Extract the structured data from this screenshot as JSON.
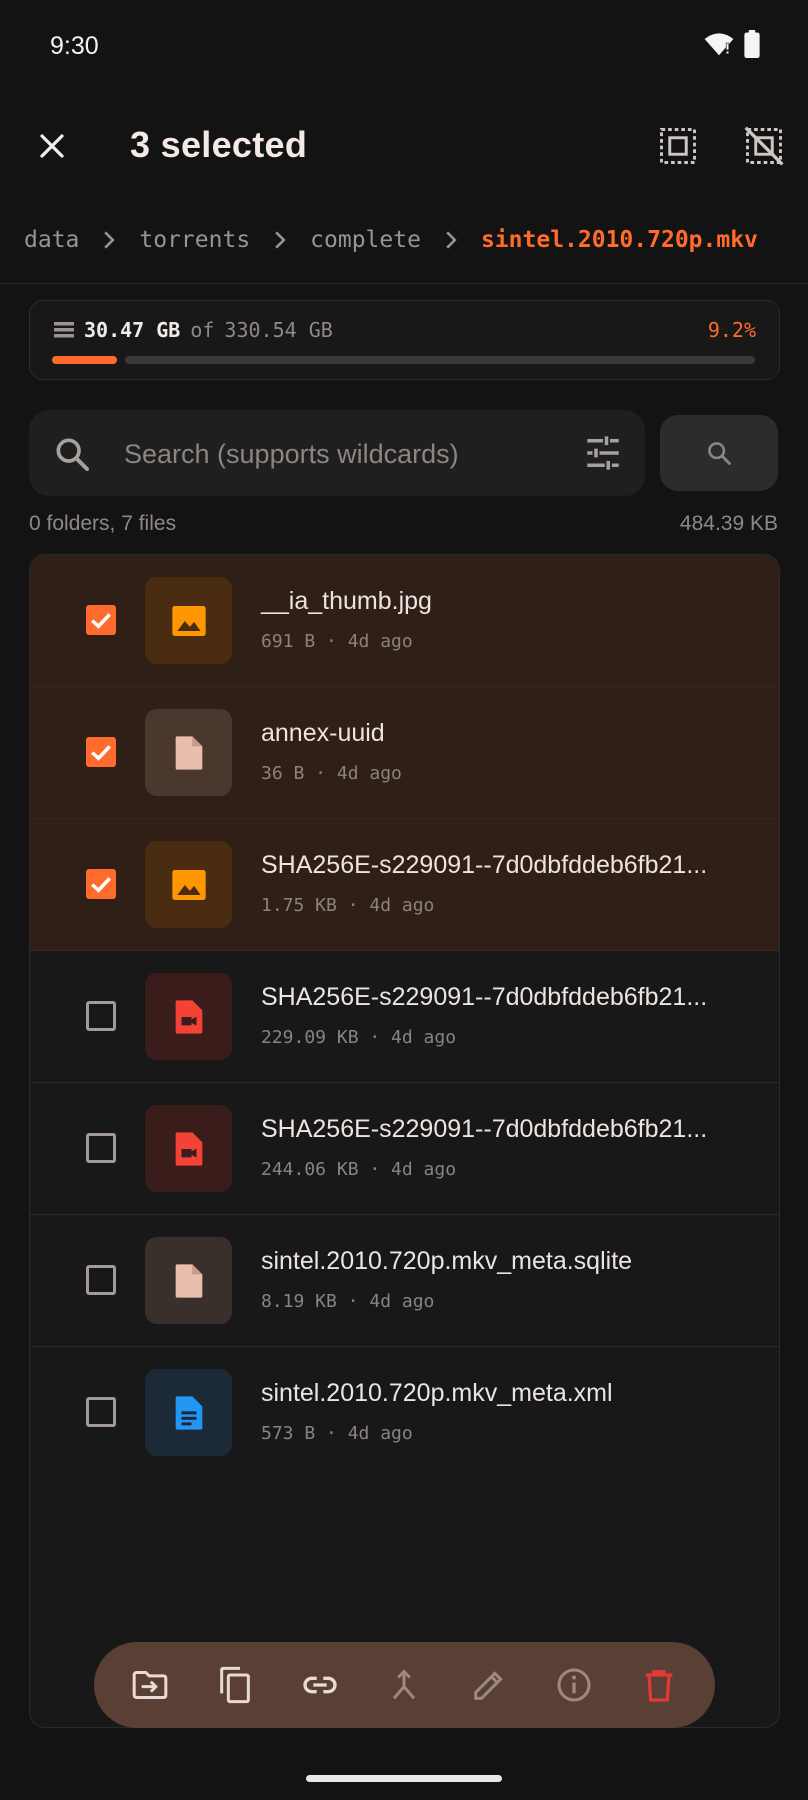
{
  "status_bar": {
    "time": "9:30"
  },
  "app_bar": {
    "title": "3 selected"
  },
  "breadcrumb": [
    "data",
    "torrents",
    "complete",
    "sintel.2010.720p.mkv"
  ],
  "storage": {
    "used": "30.47 GB",
    "of_label": "of",
    "total": "330.54 GB",
    "percent": "9.2%",
    "fraction": 0.092
  },
  "search": {
    "placeholder": "Search (supports wildcards)",
    "value": ""
  },
  "summary": {
    "counts": "0 folders, 7 files",
    "total_size": "484.39 KB"
  },
  "files": [
    {
      "name": "__ia_thumb.jpg",
      "meta": "691 B · 4d ago",
      "selected": true,
      "icon": "image-icon"
    },
    {
      "name": "annex-uuid",
      "meta": "36 B · 4d ago",
      "selected": true,
      "icon": "file-icon"
    },
    {
      "name": "SHA256E-s229091--7d0dbfddeb6fb21...",
      "meta": "1.75 KB · 4d ago",
      "selected": true,
      "icon": "image-icon"
    },
    {
      "name": "SHA256E-s229091--7d0dbfddeb6fb21...",
      "meta": "229.09 KB · 4d ago",
      "selected": false,
      "icon": "video-file-icon"
    },
    {
      "name": "SHA256E-s229091--7d0dbfddeb6fb21...",
      "meta": "244.06 KB · 4d ago",
      "selected": false,
      "icon": "video-file-icon"
    },
    {
      "name": "sintel.2010.720p.mkv_meta.sqlite",
      "meta": "8.19 KB · 4d ago",
      "selected": false,
      "icon": "file-icon"
    },
    {
      "name": "sintel.2010.720p.mkv_meta.xml",
      "meta": "573 B · 4d ago",
      "selected": false,
      "icon": "document-icon"
    }
  ],
  "colors": {
    "accent": "#ff6b2c",
    "selected_row": "#2f1f16",
    "action_bar": "#5a3f35",
    "delete": "#e53935"
  },
  "actions": [
    "move-icon",
    "copy-icon",
    "link-icon",
    "merge-icon",
    "rename-icon",
    "info-icon",
    "delete-icon"
  ]
}
